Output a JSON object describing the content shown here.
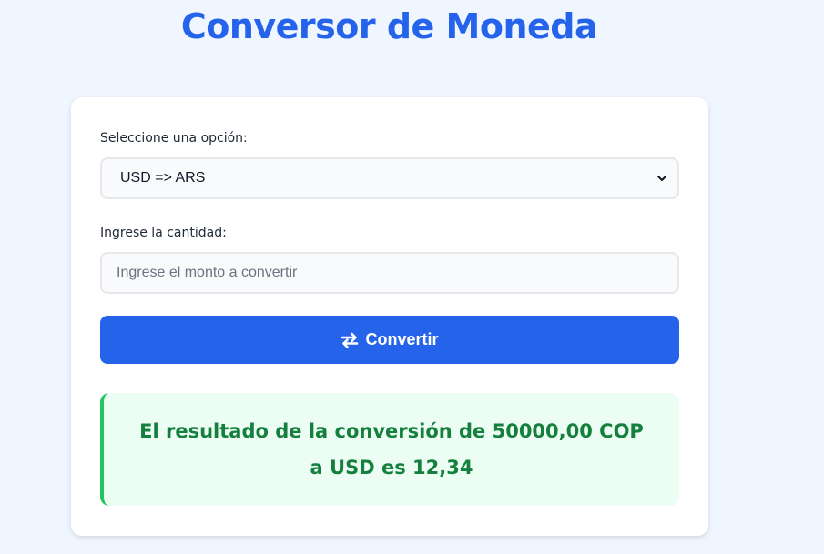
{
  "page": {
    "title": "Conversor de Moneda"
  },
  "form": {
    "select_label": "Seleccione una opción:",
    "select_value": "USD => ARS",
    "amount_label": "Ingrese la cantidad:",
    "amount_value": "",
    "amount_placeholder": "Ingrese el monto a convertir",
    "convert_label": "Convertir",
    "convert_icon": "arrows-exchange-icon"
  },
  "result": {
    "text": "El resultado de la conversión de 50000,00 COP a USD es 12,34"
  },
  "colors": {
    "accent": "#2563eb",
    "background": "#eff6ff",
    "result_text": "#15803d",
    "result_bg": "#ecfdf3",
    "result_border": "#22c55e"
  }
}
